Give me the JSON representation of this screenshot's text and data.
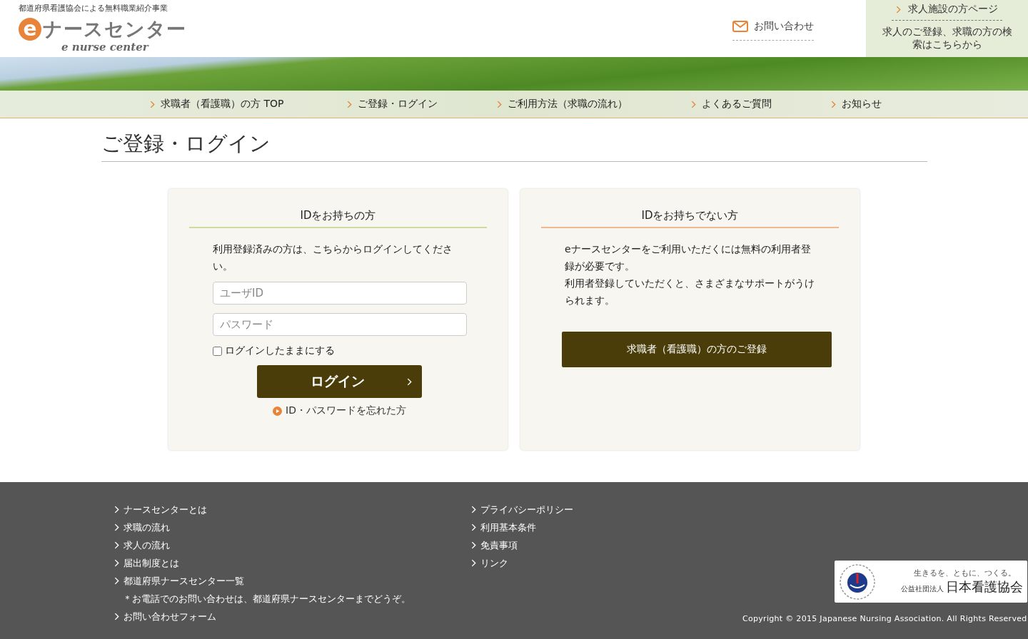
{
  "header": {
    "tagline": "都道府県看護協会による無料職業紹介事業",
    "logo": {
      "mark": "e",
      "name": "ナースセンター",
      "romaji": "e nurse center"
    },
    "contact": "お問い合わせ",
    "employer": {
      "title": "求人施設の方ページ",
      "description": "求人のご登録、求職の方の検索はこちらから"
    }
  },
  "nav": [
    {
      "label": "求職者（看護職）の方 TOP"
    },
    {
      "label": "ご登録・ログイン"
    },
    {
      "label": "ご利用方法（求職の流れ）"
    },
    {
      "label": "よくあるご質問"
    },
    {
      "label": "お知らせ"
    }
  ],
  "page_title": "ご登録・ログイン",
  "login": {
    "title": "IDをお持ちの方",
    "intro": "利用登録済みの方は、こちらからログインしてください。",
    "user_id": {
      "placeholder": "ユーザID"
    },
    "password": {
      "placeholder": "パスワード"
    },
    "remember": {
      "label": "ログインしたままにする",
      "checked": false
    },
    "button": "ログイン",
    "forgot": "ID・パスワードを忘れた方"
  },
  "register": {
    "title": "IDをお持ちでない方",
    "paragraphs": [
      "eナースセンターをご利用いただくには無料の利用者登録が必要です。",
      "利用者登録していただくと、さまざまなサポートがうけられます。"
    ],
    "button": "求職者（看護職）の方のご登録"
  },
  "footer": {
    "columns": [
      [
        {
          "kind": "link",
          "label": "ナースセンターとは"
        },
        {
          "kind": "link",
          "label": "求職の流れ"
        },
        {
          "kind": "link",
          "label": "求人の流れ"
        },
        {
          "kind": "link",
          "label": "届出制度とは"
        },
        {
          "kind": "link",
          "label": "都道府県ナースセンター一覧"
        },
        {
          "kind": "note",
          "label": "＊お電話でのお問い合わせは、都道府県ナースセンターまでどうぞ。"
        },
        {
          "kind": "link",
          "label": "お問い合わせフォーム"
        }
      ],
      [
        {
          "kind": "link",
          "label": "プライバシーポリシー"
        },
        {
          "kind": "link",
          "label": "利用基本条件"
        },
        {
          "kind": "link",
          "label": "免責事項"
        },
        {
          "kind": "link",
          "label": "リンク"
        }
      ]
    ],
    "association": {
      "slogan": "生きるを、ともに、つくる。",
      "type": "公益社団法人",
      "name": "日本看護協会"
    },
    "copyright": "Copyright © 2015 Japanese Nursing Association. All Rights Reserved"
  }
}
